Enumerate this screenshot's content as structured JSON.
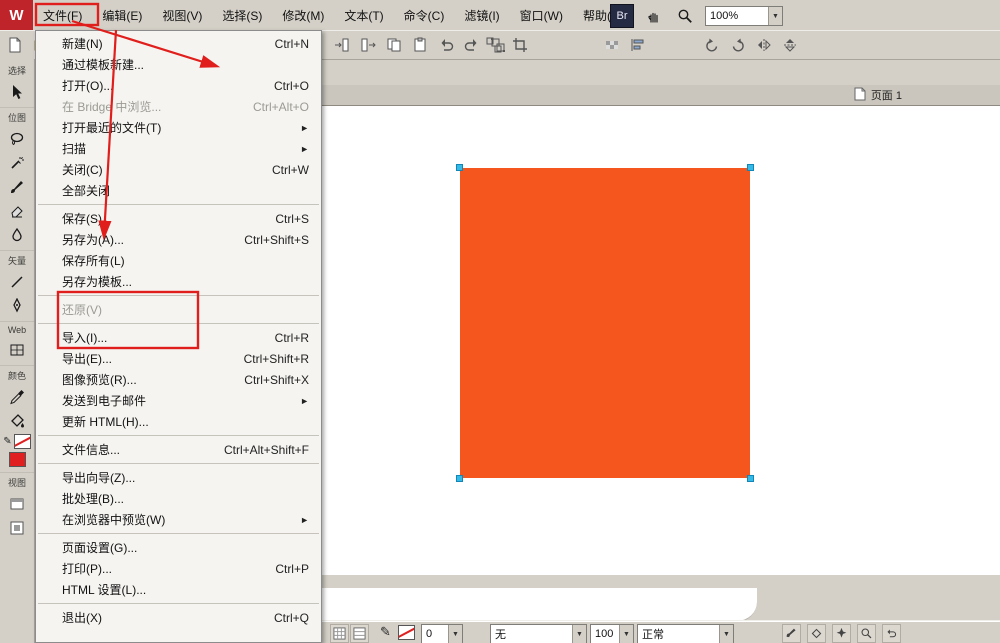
{
  "window": {
    "logo_letter": "W",
    "bridge_label": "Br",
    "zoom_value": "100%"
  },
  "menubar": {
    "items": [
      "文件(F)",
      "编辑(E)",
      "视图(V)",
      "选择(S)",
      "修改(M)",
      "文本(T)",
      "命令(C)",
      "滤镜(I)",
      "窗口(W)",
      "帮助(H)"
    ]
  },
  "file_menu": {
    "items": [
      {
        "label": "新建(N)",
        "shortcut": "Ctrl+N"
      },
      {
        "label": "通过模板新建...",
        "shortcut": ""
      },
      {
        "label": "打开(O)...",
        "shortcut": "Ctrl+O"
      },
      {
        "label": "在 Bridge 中浏览...",
        "shortcut": "Ctrl+Alt+O"
      },
      {
        "label": "打开最近的文件(T)",
        "shortcut": ""
      },
      {
        "label": "扫描",
        "shortcut": ""
      },
      {
        "label": "关闭(C)",
        "shortcut": "Ctrl+W"
      },
      {
        "label": "全部关闭",
        "shortcut": ""
      },
      {
        "label": "保存(S)",
        "shortcut": "Ctrl+S"
      },
      {
        "label": "另存为(A)...",
        "shortcut": "Ctrl+Shift+S"
      },
      {
        "label": "保存所有(L)",
        "shortcut": ""
      },
      {
        "label": "另存为模板...",
        "shortcut": ""
      },
      {
        "label": "还原(V)",
        "shortcut": ""
      },
      {
        "label": "导入(I)...",
        "shortcut": "Ctrl+R"
      },
      {
        "label": "导出(E)...",
        "shortcut": "Ctrl+Shift+R"
      },
      {
        "label": "图像预览(R)...",
        "shortcut": "Ctrl+Shift+X"
      },
      {
        "label": "发送到电子邮件",
        "shortcut": ""
      },
      {
        "label": "更新 HTML(H)...",
        "shortcut": ""
      },
      {
        "label": "文件信息...",
        "shortcut": "Ctrl+Alt+Shift+F"
      },
      {
        "label": "导出向导(Z)...",
        "shortcut": ""
      },
      {
        "label": "批处理(B)...",
        "shortcut": ""
      },
      {
        "label": "在浏览器中预览(W)",
        "shortcut": ""
      },
      {
        "label": "页面设置(G)...",
        "shortcut": ""
      },
      {
        "label": "打印(P)...",
        "shortcut": "Ctrl+P"
      },
      {
        "label": "HTML 设置(L)...",
        "shortcut": ""
      },
      {
        "label": "退出(X)",
        "shortcut": "Ctrl+Q"
      }
    ]
  },
  "left_toolbox": {
    "sections": [
      "选择",
      "位图",
      "矢量",
      "Web",
      "颜色",
      "视图"
    ]
  },
  "document": {
    "page_tab": "页面 1"
  },
  "properties_bar": {
    "tip_size": "0",
    "edge": "无",
    "opacity": "100",
    "blend_mode": "正常"
  },
  "icons": {
    "submenu_arrow": "►",
    "dropdown_arrow": "▼",
    "pencil": "✎"
  },
  "colors": {
    "annotation": "#e01f1c",
    "object_fill": "#f4561d",
    "selection_handle": "#35b9e6",
    "chrome": "#d4d0c8"
  }
}
